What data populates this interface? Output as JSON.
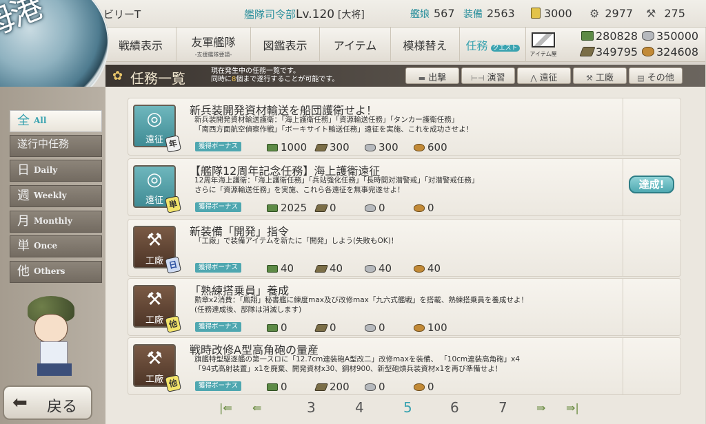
{
  "topbar": {
    "player_name": "ビリーT",
    "hq_label": "艦隊司令部",
    "hq_level": "Lv.120",
    "rank": "[大将]",
    "ships_label": "艦娘",
    "ships_count": "567",
    "equip_label": "装備",
    "equip_count": "2563",
    "bucket_count": "3000",
    "devmat_count": "2977",
    "screw_count": "275"
  },
  "emblem_text": "母港",
  "menu": {
    "items": [
      {
        "label": "戦績表示",
        "sub": ""
      },
      {
        "label": "友軍艦隊",
        "sub": "-支援艦隊要請-"
      },
      {
        "label": "図鑑表示",
        "sub": ""
      },
      {
        "label": "アイテム",
        "sub": ""
      },
      {
        "label": "模様替え",
        "sub": ""
      },
      {
        "label": "任務",
        "sub": "クエスト"
      }
    ],
    "shop_label": "アイテム屋",
    "resources": {
      "fuel": "280828",
      "ammo": "349795",
      "steel": "350000",
      "bauxite": "324608"
    }
  },
  "quest_header": {
    "title": "任務一覧",
    "desc_line1": "現在発生中の任務一覧です。",
    "desc_line2_pre": "同時に",
    "desc_line2_num": "8",
    "desc_line2_post": "個まで遂行することが可能です。",
    "filters": [
      "出撃",
      "演習",
      "遠征",
      "工廠",
      "その他"
    ]
  },
  "left_tabs": [
    {
      "kanji": "全",
      "en": "All"
    },
    {
      "kanji": "遂行中任務",
      "en": ""
    },
    {
      "kanji": "日",
      "en": "Daily"
    },
    {
      "kanji": "週",
      "en": "Weekly"
    },
    {
      "kanji": "月",
      "en": "Monthly"
    },
    {
      "kanji": "単",
      "en": "Once"
    },
    {
      "kanji": "他",
      "en": "Others"
    }
  ],
  "quests": [
    {
      "category": "遠征",
      "type": "年",
      "type_sub": "3",
      "title": "新兵装開発資材輸送を船団護衛せよ！",
      "desc": "新兵装開発資材輸送護衛：「海上護衛任務」「資源輸送任務」「タンカー護衛任務」\n「南西方面航空偵察作戦」「ボーキサイト輸送任務」遠征を実施、これを成功させよ！",
      "bonus": "獲得ボーナス",
      "fuel": "1000",
      "ammo": "300",
      "steel": "300",
      "bauxite": "600",
      "status": ""
    },
    {
      "category": "遠征",
      "type": "単",
      "type_sub": "",
      "title": "【艦隊12周年記念任務】海上護衛遠征",
      "desc": "12周年海上護衛：「海上護衛任務」「兵站強化任務」「長時間対潜警戒」「対潜警戒任務」\nさらに「資源輸送任務」を実施、これら各遠征を無事完遂せよ！",
      "bonus": "獲得ボーナス",
      "fuel": "2025",
      "ammo": "0",
      "steel": "0",
      "bauxite": "0",
      "status": "達成!"
    },
    {
      "category": "工廠",
      "type": "日",
      "type_sub": "",
      "title": "新装備「開発」指令",
      "desc": "「工廠」で装備アイテムを新たに「開発」しよう(失敗もOK)！",
      "bonus": "獲得ボーナス",
      "fuel": "40",
      "ammo": "40",
      "steel": "40",
      "bauxite": "40",
      "status": ""
    },
    {
      "category": "工廠",
      "type": "他",
      "type_sub": "",
      "title": "「熟練搭乗員」養成",
      "desc": "勲章x2消費：「鳳翔」秘書艦に練度max及び改修max「九六式艦戦」を搭載、熟練搭乗員を養成せよ！\n(任務達成後、部隊は消滅します)",
      "bonus": "獲得ボーナス",
      "fuel": "0",
      "ammo": "0",
      "steel": "0",
      "bauxite": "100",
      "status": ""
    },
    {
      "category": "工廠",
      "type": "他",
      "type_sub": "",
      "title": "戦時改修A型高角砲の量産",
      "desc": "旗艦特型駆逐艦の第一スロに「12.7cm連装砲A型改二」改修maxを装備、 「10cm連装高角砲」x4\n「94式高射装置」x1を廃棄、開発資材x30、鋼材900、新型砲熕兵装資材x1を再び準備せよ！",
      "bonus": "獲得ボーナス",
      "fuel": "0",
      "ammo": "200",
      "steel": "0",
      "bauxite": "0",
      "status": ""
    }
  ],
  "pager": {
    "pages": [
      "3",
      "4",
      "5",
      "6",
      "7"
    ],
    "current": "5"
  },
  "back_label": "戻る"
}
